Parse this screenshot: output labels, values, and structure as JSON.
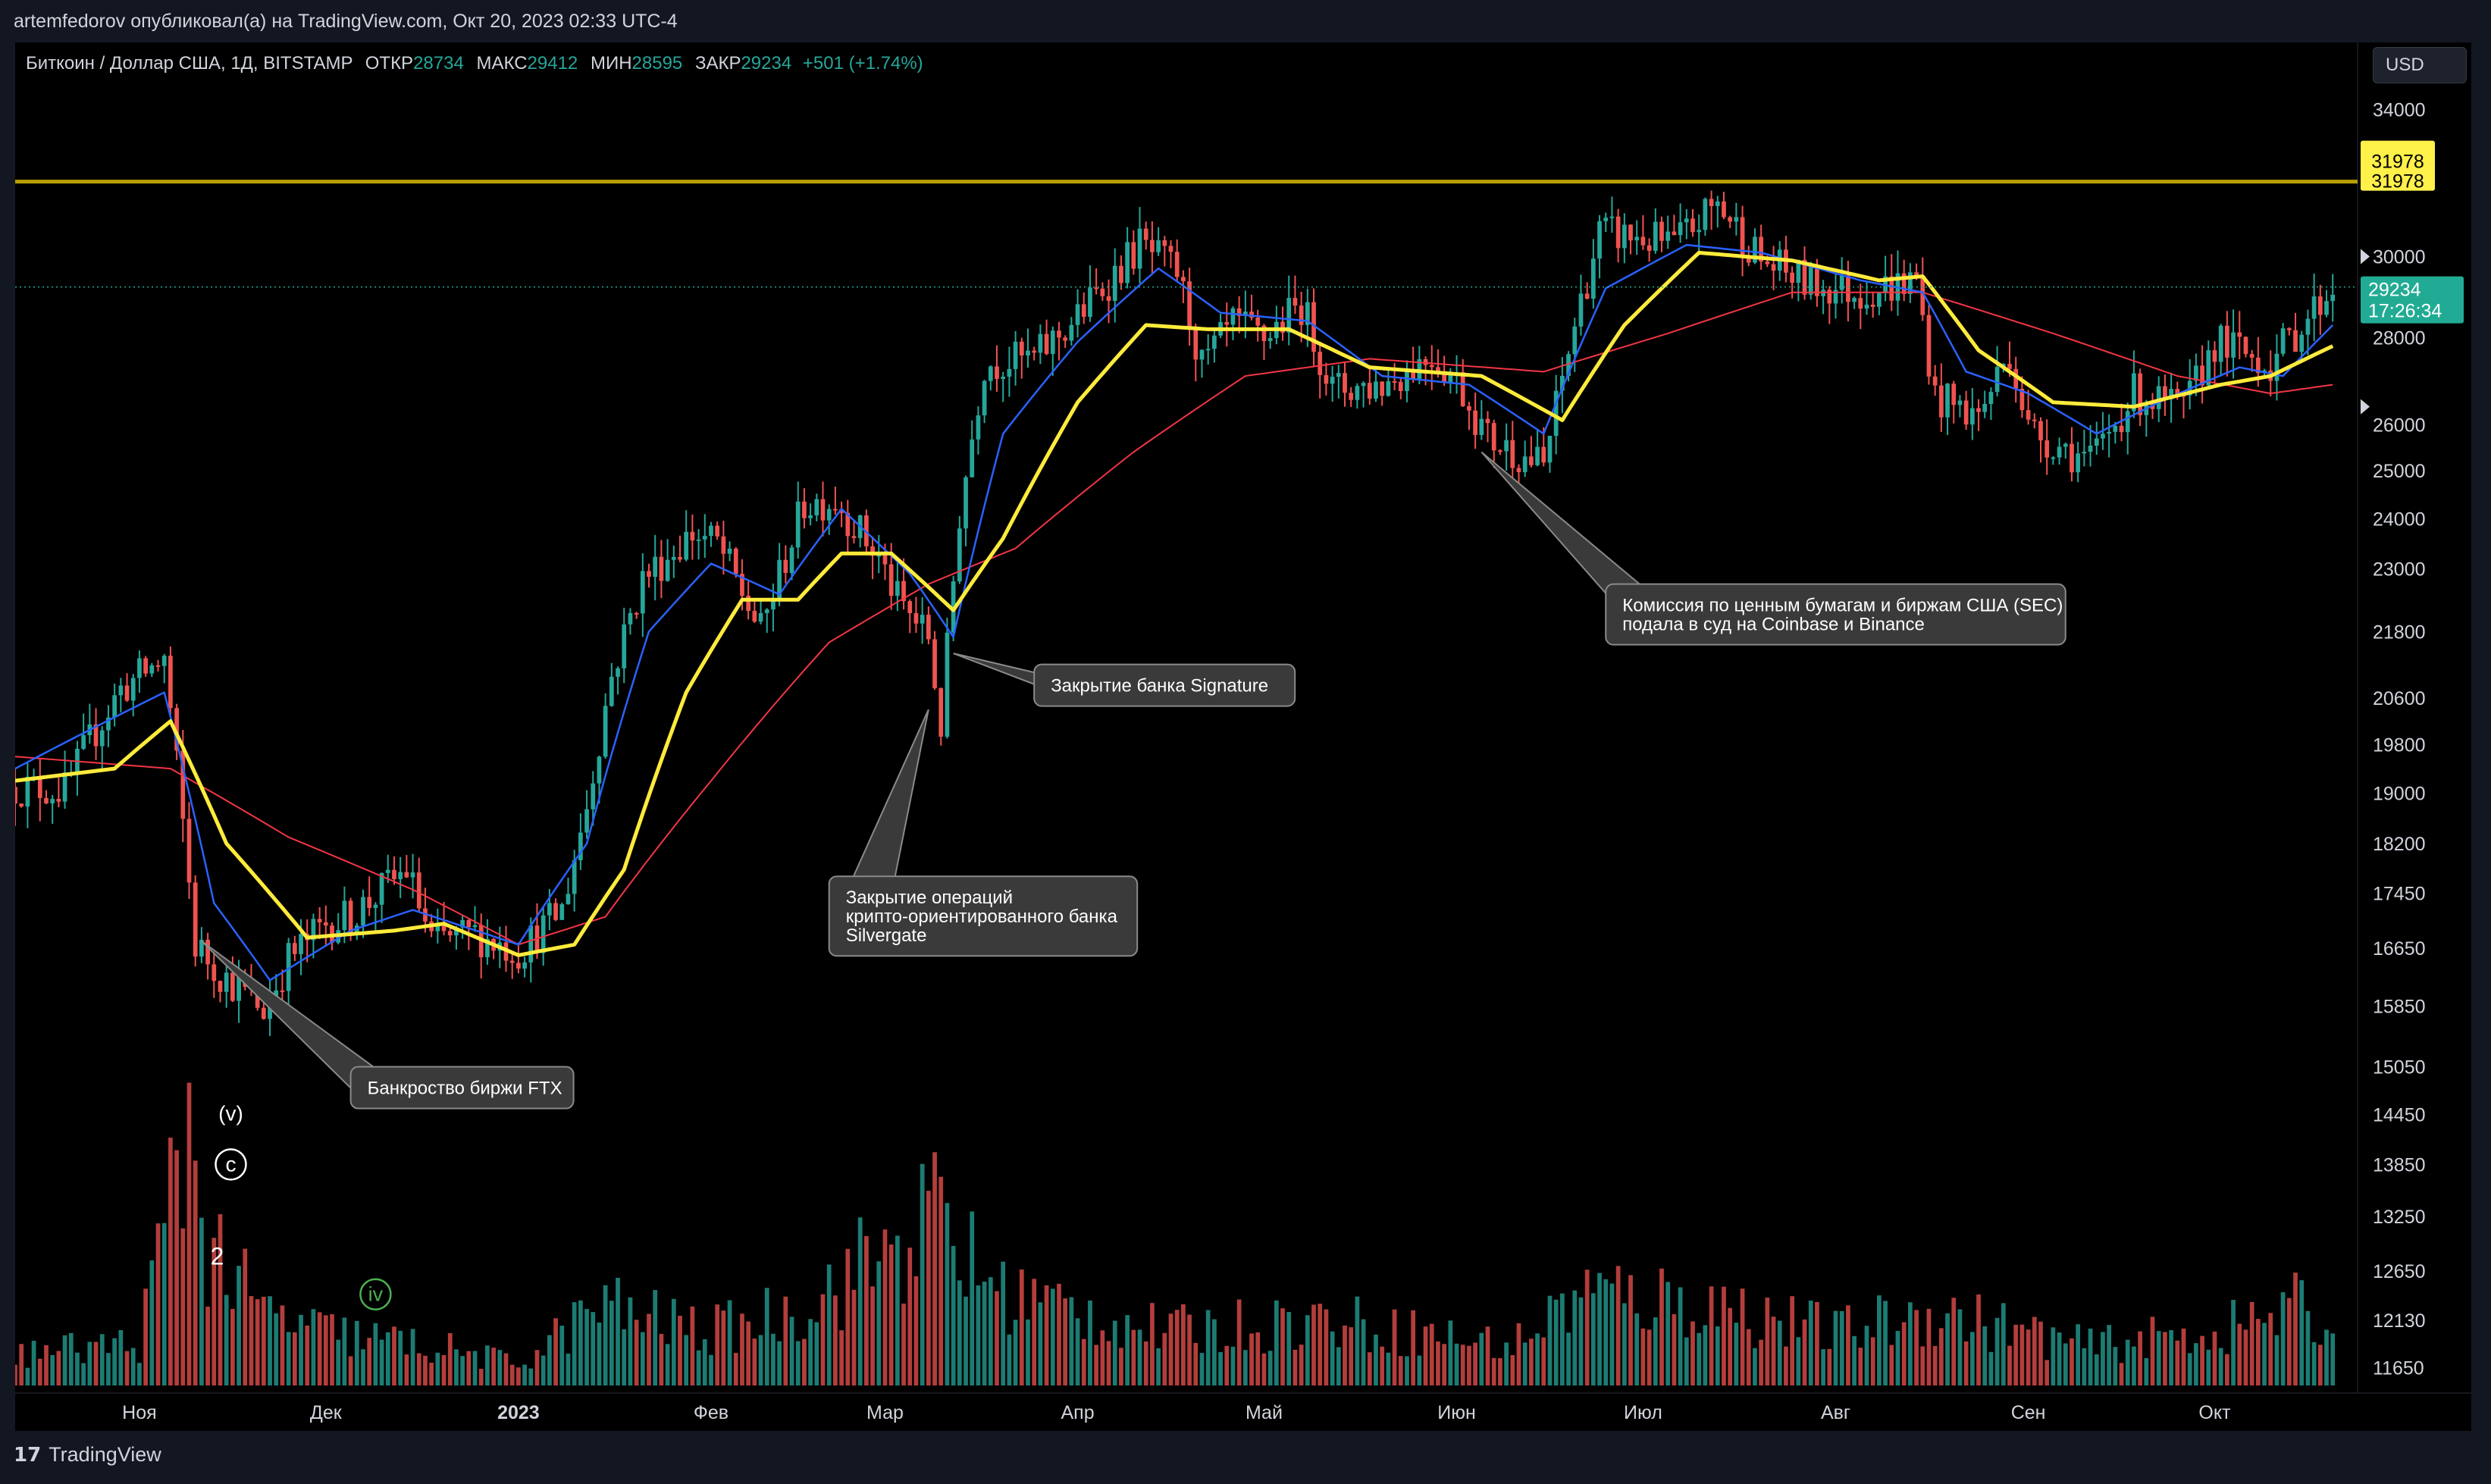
{
  "header": {
    "published": "artemfedorov опубликовал(а) на TradingView.com, Окт 20, 2023 02:33 UTC-4"
  },
  "legend": {
    "symbol": "Биткоин / Доллар США, 1Д, BITSTAMP",
    "open_label": "ОТКР",
    "open": "28734",
    "high_label": "МАКС",
    "high": "29412",
    "low_label": "МИН",
    "low": "28595",
    "close_label": "ЗАКР",
    "close": "29234",
    "change": "+501 (+1.74%)"
  },
  "currency": "USD",
  "footer": {
    "brand": "TradingView",
    "logo_icon": "tradingview-logo-icon"
  },
  "colors": {
    "up": "#26a69a",
    "down": "#ef5350",
    "ema_fast": "#2962ff",
    "ema_mid": "#ffeb3b",
    "ema_slow": "#f23645",
    "level": "#b8a000",
    "level_badge": "#fff04a",
    "price_badge": "#22ab94"
  },
  "chart_data": {
    "type": "line",
    "title": "",
    "y_scale": "log",
    "ylim": [
      11400,
      36000
    ],
    "y_ticks": [
      34000,
      30000,
      28000,
      26000,
      25000,
      24000,
      23000,
      21800,
      20600,
      19800,
      19000,
      18200,
      17450,
      16650,
      15850,
      15050,
      14450,
      13850,
      13250,
      12650,
      12130,
      11650
    ],
    "x_range": [
      "2022-10-12",
      "2023-10-24"
    ],
    "x_ticks": [
      {
        "date": "2022-11-01",
        "label": "Ноя",
        "bold": false
      },
      {
        "date": "2022-12-01",
        "label": "Дек",
        "bold": false
      },
      {
        "date": "2023-01-01",
        "label": "2023",
        "bold": true
      },
      {
        "date": "2023-02-01",
        "label": "Фев",
        "bold": false
      },
      {
        "date": "2023-03-01",
        "label": "Мар",
        "bold": false
      },
      {
        "date": "2023-04-01",
        "label": "Апр",
        "bold": false
      },
      {
        "date": "2023-05-01",
        "label": "Май",
        "bold": false
      },
      {
        "date": "2023-06-01",
        "label": "Июн",
        "bold": false
      },
      {
        "date": "2023-07-01",
        "label": "Июл",
        "bold": false
      },
      {
        "date": "2023-08-01",
        "label": "Авг",
        "bold": false
      },
      {
        "date": "2023-09-01",
        "label": "Сен",
        "bold": false
      },
      {
        "date": "2023-10-01",
        "label": "Окт",
        "bold": false
      }
    ],
    "close_path": [
      [
        "2022-10-12",
        19100
      ],
      [
        "2022-10-20",
        19050
      ],
      [
        "2022-10-25",
        20050
      ],
      [
        "2022-10-29",
        20750
      ],
      [
        "2022-11-05",
        21300
      ],
      [
        "2022-11-08",
        18500
      ],
      [
        "2022-11-10",
        16700
      ],
      [
        "2022-11-14",
        16300
      ],
      [
        "2022-11-21",
        15800
      ],
      [
        "2022-11-25",
        16500
      ],
      [
        "2022-12-01",
        17000
      ],
      [
        "2022-12-05",
        17100
      ],
      [
        "2022-12-14",
        17800
      ],
      [
        "2022-12-18",
        16750
      ],
      [
        "2022-12-25",
        16850
      ],
      [
        "2023-01-01",
        16600
      ],
      [
        "2023-01-08",
        17200
      ],
      [
        "2023-01-12",
        18800
      ],
      [
        "2023-01-16",
        21000
      ],
      [
        "2023-01-21",
        22800
      ],
      [
        "2023-01-29",
        23700
      ],
      [
        "2023-02-02",
        23500
      ],
      [
        "2023-02-09",
        21800
      ],
      [
        "2023-02-16",
        24300
      ],
      [
        "2023-02-21",
        24400
      ],
      [
        "2023-02-28",
        23200
      ],
      [
        "2023-03-03",
        22400
      ],
      [
        "2023-03-08",
        21700
      ],
      [
        "2023-03-10",
        20100
      ],
      [
        "2023-03-13",
        24100
      ],
      [
        "2023-03-17",
        27400
      ],
      [
        "2023-03-25",
        27500
      ],
      [
        "2023-04-01",
        28500
      ],
      [
        "2023-04-11",
        30300
      ],
      [
        "2023-04-17",
        29600
      ],
      [
        "2023-04-21",
        27300
      ],
      [
        "2023-04-26",
        28300
      ],
      [
        "2023-05-01",
        28000
      ],
      [
        "2023-05-07",
        28800
      ],
      [
        "2023-05-12",
        26800
      ],
      [
        "2023-05-20",
        26900
      ],
      [
        "2023-05-28",
        27600
      ],
      [
        "2023-06-01",
        27000
      ],
      [
        "2023-06-06",
        25700
      ],
      [
        "2023-06-15",
        25100
      ],
      [
        "2023-06-20",
        28300
      ],
      [
        "2023-06-24",
        30600
      ],
      [
        "2023-06-30",
        30500
      ],
      [
        "2023-07-06",
        30300
      ],
      [
        "2023-07-13",
        31400
      ],
      [
        "2023-07-20",
        29900
      ],
      [
        "2023-07-28",
        29300
      ],
      [
        "2023-08-05",
        29100
      ],
      [
        "2023-08-14",
        29400
      ],
      [
        "2023-08-17",
        26600
      ],
      [
        "2023-08-24",
        26200
      ],
      [
        "2023-08-29",
        27700
      ],
      [
        "2023-09-01",
        25900
      ],
      [
        "2023-09-11",
        25200
      ],
      [
        "2023-09-18",
        26700
      ],
      [
        "2023-09-26",
        26300
      ],
      [
        "2023-10-01",
        27900
      ],
      [
        "2023-10-10",
        27400
      ],
      [
        "2023-10-16",
        28500
      ],
      [
        "2023-10-20",
        29234
      ]
    ],
    "ema_fast_path": [
      [
        "2022-10-12",
        19400
      ],
      [
        "2022-11-05",
        20700
      ],
      [
        "2022-11-13",
        17300
      ],
      [
        "2022-11-22",
        16200
      ],
      [
        "2022-12-05",
        16900
      ],
      [
        "2022-12-15",
        17200
      ],
      [
        "2023-01-01",
        16700
      ],
      [
        "2023-01-12",
        18200
      ],
      [
        "2023-01-22",
        21800
      ],
      [
        "2023-02-01",
        23100
      ],
      [
        "2023-02-12",
        22500
      ],
      [
        "2023-02-22",
        24200
      ],
      [
        "2023-03-05",
        22900
      ],
      [
        "2023-03-12",
        21700
      ],
      [
        "2023-03-20",
        25800
      ],
      [
        "2023-04-01",
        27900
      ],
      [
        "2023-04-14",
        29700
      ],
      [
        "2023-04-24",
        28600
      ],
      [
        "2023-05-08",
        28400
      ],
      [
        "2023-05-20",
        27100
      ],
      [
        "2023-06-03",
        26900
      ],
      [
        "2023-06-15",
        25800
      ],
      [
        "2023-06-25",
        29200
      ],
      [
        "2023-07-08",
        30300
      ],
      [
        "2023-07-20",
        30100
      ],
      [
        "2023-08-05",
        29400
      ],
      [
        "2023-08-15",
        29100
      ],
      [
        "2023-08-22",
        27200
      ],
      [
        "2023-09-01",
        26700
      ],
      [
        "2023-09-12",
        25800
      ],
      [
        "2023-09-22",
        26500
      ],
      [
        "2023-10-05",
        27300
      ],
      [
        "2023-10-12",
        27100
      ],
      [
        "2023-10-20",
        28300
      ]
    ],
    "ema_mid_path": [
      [
        "2022-10-12",
        19200
      ],
      [
        "2022-10-28",
        19400
      ],
      [
        "2022-11-06",
        20200
      ],
      [
        "2022-11-15",
        18200
      ],
      [
        "2022-11-28",
        16800
      ],
      [
        "2022-12-12",
        16900
      ],
      [
        "2022-12-20",
        17000
      ],
      [
        "2023-01-01",
        16550
      ],
      [
        "2023-01-10",
        16700
      ],
      [
        "2023-01-18",
        17800
      ],
      [
        "2023-01-28",
        20700
      ],
      [
        "2023-02-06",
        22400
      ],
      [
        "2023-02-15",
        22400
      ],
      [
        "2023-02-22",
        23300
      ],
      [
        "2023-03-02",
        23300
      ],
      [
        "2023-03-12",
        22200
      ],
      [
        "2023-03-20",
        23600
      ],
      [
        "2023-04-01",
        26500
      ],
      [
        "2023-04-12",
        28300
      ],
      [
        "2023-04-22",
        28200
      ],
      [
        "2023-05-05",
        28200
      ],
      [
        "2023-05-18",
        27300
      ],
      [
        "2023-06-05",
        27100
      ],
      [
        "2023-06-18",
        26100
      ],
      [
        "2023-06-28",
        28300
      ],
      [
        "2023-07-10",
        30100
      ],
      [
        "2023-07-25",
        29900
      ],
      [
        "2023-08-08",
        29400
      ],
      [
        "2023-08-15",
        29500
      ],
      [
        "2023-08-24",
        27700
      ],
      [
        "2023-09-05",
        26500
      ],
      [
        "2023-09-18",
        26400
      ],
      [
        "2023-10-02",
        26900
      ],
      [
        "2023-10-10",
        27100
      ],
      [
        "2023-10-20",
        27800
      ]
    ],
    "ema_slow_path": [
      [
        "2022-10-12",
        19600
      ],
      [
        "2022-11-06",
        19400
      ],
      [
        "2022-11-25",
        18300
      ],
      [
        "2022-12-15",
        17500
      ],
      [
        "2023-01-01",
        16700
      ],
      [
        "2023-01-15",
        17100
      ],
      [
        "2023-02-01",
        19200
      ],
      [
        "2023-02-20",
        21600
      ],
      [
        "2023-03-08",
        22700
      ],
      [
        "2023-03-22",
        23400
      ],
      [
        "2023-04-10",
        25400
      ],
      [
        "2023-04-28",
        27100
      ],
      [
        "2023-05-18",
        27500
      ],
      [
        "2023-06-15",
        27200
      ],
      [
        "2023-07-05",
        28100
      ],
      [
        "2023-07-25",
        29100
      ],
      [
        "2023-08-15",
        29100
      ],
      [
        "2023-09-05",
        28100
      ],
      [
        "2023-09-25",
        27100
      ],
      [
        "2023-10-10",
        26700
      ],
      [
        "2023-10-20",
        26900
      ]
    ],
    "volume_path": [
      [
        "2022-10-12",
        0.12
      ],
      [
        "2022-11-01",
        0.16
      ],
      [
        "2022-11-09",
        1.0
      ],
      [
        "2022-11-10",
        0.85
      ],
      [
        "2022-11-12",
        0.55
      ],
      [
        "2022-11-20",
        0.28
      ],
      [
        "2022-12-01",
        0.2
      ],
      [
        "2022-12-20",
        0.14
      ],
      [
        "2023-01-01",
        0.08
      ],
      [
        "2023-01-14",
        0.3
      ],
      [
        "2023-02-01",
        0.2
      ],
      [
        "2023-02-16",
        0.3
      ],
      [
        "2023-03-10",
        0.65
      ],
      [
        "2023-03-13",
        0.5
      ],
      [
        "2023-03-20",
        0.35
      ],
      [
        "2023-04-15",
        0.2
      ],
      [
        "2023-05-10",
        0.25
      ],
      [
        "2023-06-10",
        0.15
      ],
      [
        "2023-06-21",
        0.35
      ],
      [
        "2023-07-13",
        0.3
      ],
      [
        "2023-08-01",
        0.2
      ],
      [
        "2023-08-17",
        0.28
      ],
      [
        "2023-09-10",
        0.15
      ],
      [
        "2023-10-01",
        0.2
      ],
      [
        "2023-10-16",
        0.3
      ],
      [
        "2023-10-20",
        0.15
      ]
    ],
    "resistance_level": 31978,
    "last_price": 29234,
    "countdown": "17:26:34",
    "annotations": [
      {
        "text": [
          "Банкроство биржи FTX"
        ],
        "anchor_date": "2022-11-11",
        "anchor_price": 16750,
        "box_date": "2022-12-05",
        "box_price": 15050
      },
      {
        "text": [
          "Закрытие операций",
          "крипто-ориентированного банка",
          "Silvergate"
        ],
        "anchor_date": "2023-03-08",
        "anchor_price": 20400,
        "box_date": "2023-02-20",
        "box_price": 17700
      },
      {
        "text": [
          "Закрытие банка Signature"
        ],
        "anchor_date": "2023-03-12",
        "anchor_price": 21400,
        "box_date": "2023-03-25",
        "box_price": 21200
      },
      {
        "text": [
          "Комиссия по ценным бумагам и биржам США (SEC)",
          "подала в суд на Coinbase и Binance"
        ],
        "anchor_date": "2023-06-05",
        "anchor_price": 25400,
        "box_date": "2023-06-25",
        "box_price": 22700
      }
    ],
    "wave_labels": [
      {
        "text": "(v)",
        "style": "plain"
      },
      {
        "text": "c",
        "style": "circle-white"
      },
      {
        "text": "2",
        "style": "plain"
      },
      {
        "text": "iv",
        "style": "circle-green"
      }
    ]
  }
}
